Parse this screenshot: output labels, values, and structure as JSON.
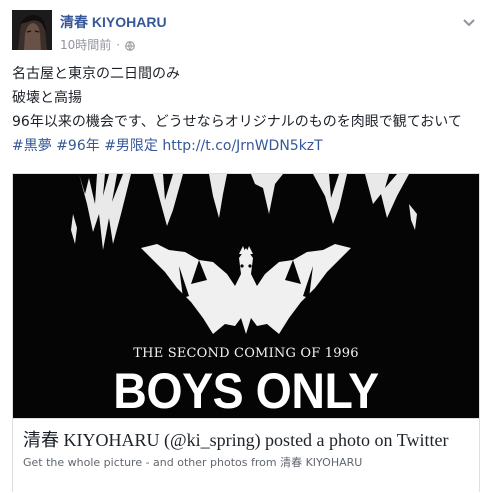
{
  "header": {
    "author": "清春 KIYOHARU",
    "time": "10時間前",
    "separator": "·"
  },
  "post": {
    "lines": [
      "名古屋と東京の二日間のみ",
      "破壊と高揚",
      "96年以来の機会です、どうせならオリジナルのものを肉眼で観ておいて"
    ],
    "tags": [
      "#黒夢",
      "#96年",
      "#男限定"
    ],
    "link": "http://t.co/JrnWDN5kzT"
  },
  "attachment": {
    "image": {
      "subhead": "THE SECOND COMING OF 1996",
      "headline": "BOYS ONLY"
    },
    "title": "清春 KIYOHARU (@ki_spring) posted a photo on Twitter",
    "description": "Get the whole picture - and other photos from 清春 KIYOHARU"
  },
  "icons": {
    "audience": "globe-icon",
    "menu": "chevron-down-icon"
  },
  "colors": {
    "link": "#365899",
    "meta": "#90949c",
    "photo_bg": "#050505"
  }
}
